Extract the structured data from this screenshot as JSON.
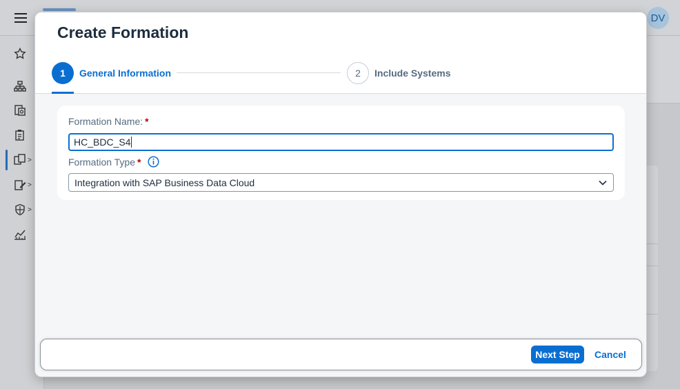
{
  "shell": {
    "avatar_initials": "DV",
    "nav_items": [
      "star-icon",
      "hierarchy-icon",
      "documents-icon",
      "clipboard-icon",
      "connected-icon",
      "edit-icon",
      "shield-icon",
      "analytics-icon"
    ]
  },
  "dialog": {
    "title": "Create Formation",
    "steps": [
      {
        "number": "1",
        "label": "General Information",
        "state": "active"
      },
      {
        "number": "2",
        "label": "Include Systems",
        "state": "inactive"
      }
    ],
    "fields": {
      "formation_name": {
        "label": "Formation Name:",
        "required_mark": "*",
        "value": "HC_BDC_S4"
      },
      "formation_type": {
        "label": "Formation Type",
        "required_mark": "*",
        "selected": "Integration with SAP Business Data Cloud"
      }
    },
    "footer": {
      "next_label": "Next Step",
      "cancel_label": "Cancel"
    }
  },
  "colors": {
    "accent": "#0a6ed1",
    "required": "#aa0808",
    "text": "#1d2d3e",
    "label": "#556b82"
  }
}
